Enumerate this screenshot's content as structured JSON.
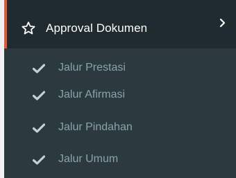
{
  "menu": {
    "title": "Approval Dokumen",
    "icon": "star-icon",
    "expand_icon": "chevron-right-icon",
    "accent_color": "#e0593a",
    "items": [
      {
        "label": "Jalur Prestasi",
        "icon": "check-icon"
      },
      {
        "label": "Jalur Afirmasi",
        "icon": "check-icon"
      },
      {
        "label": "Jalur Pindahan",
        "icon": "check-icon"
      },
      {
        "label": "Jalur Umum",
        "icon": "check-icon"
      }
    ]
  }
}
